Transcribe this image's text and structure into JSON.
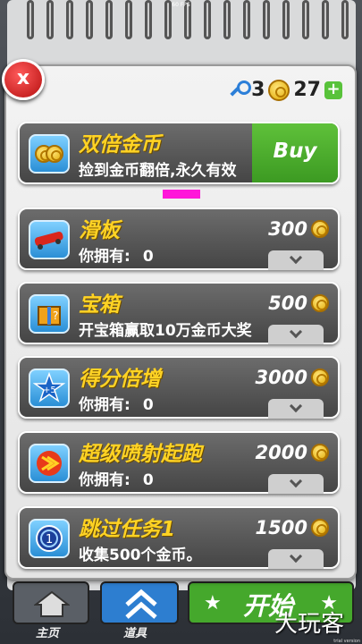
{
  "status": {
    "fps": "60 FPS"
  },
  "currency": {
    "keys": "3",
    "coins": "27",
    "plus": "+"
  },
  "close_label": "x",
  "featured": {
    "title": "双倍金币",
    "subtitle": "捡到金币翻倍,永久有效",
    "buy_label": "Buy"
  },
  "items": [
    {
      "title": "滑板",
      "owned_label": "你拥有:",
      "owned_value": "0",
      "price": "300",
      "icon": "skateboard-icon"
    },
    {
      "title": "宝箱",
      "desc": "开宝箱赢取10万金币大奖",
      "price": "500",
      "icon": "mystery-box-icon"
    },
    {
      "title": "得分倍增",
      "owned_label": "你拥有:",
      "owned_value": "0",
      "price": "3000",
      "icon": "score-multiplier-icon"
    },
    {
      "title": "超级喷射起跑",
      "owned_label": "你拥有:",
      "owned_value": "0",
      "price": "2000",
      "icon": "super-jet-start-icon"
    },
    {
      "title": "跳过任务1",
      "desc": "收集500个金币。",
      "price": "1500",
      "icon": "skip-mission-icon"
    }
  ],
  "nav": {
    "home": "主页",
    "items": "道具",
    "start": "开始"
  },
  "watermark": "大玩客",
  "trial_text": "trial version",
  "colors": {
    "title_yellow": "#ffd324",
    "buy_green": "#4caf2a",
    "accent_pink": "#ff16d9",
    "close_red": "#d62020"
  }
}
